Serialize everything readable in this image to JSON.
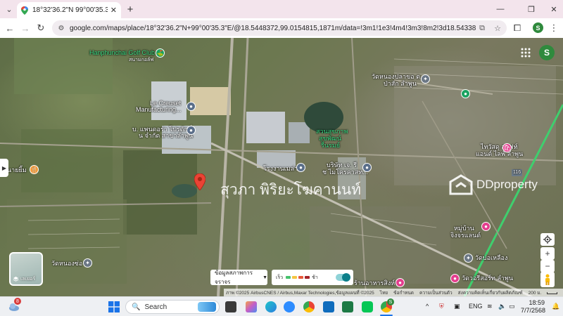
{
  "browser": {
    "tab_title": "18°32'36.2\"N 99°00'35.3\"E - Google Maps",
    "url": "google.com/maps/place/18°32'36.2\"N+99°00'35.3\"E/@18.5448372,99.0154815,1871m/data=!3m1!1e3!4m4!3m3!8m2!3d18.5433889!4d99.00980",
    "profile_initial": "S"
  },
  "map": {
    "labels": {
      "golf_club": "Hanphunchai Golf Club",
      "golf_club_th": "สนามกอล์ฟ",
      "le_creuset": "Le Creuset",
      "le_creuset_2": "Manufacturing...",
      "company_left_1": "บ. แพนดอร่า โปรดักชั่",
      "company_left_2": "น จำกัด สาขาลำพูน",
      "temple_top_1": "วัดหนองปลาขอ ต.",
      "temple_top_2": "ป่าสัก ลำพูน",
      "park_1": "สวนสุขภาพ",
      "park_2": "สุขพัฒน์",
      "park_3": "รื่นรมย์",
      "factory": "โรงงานเมล่า",
      "company_mid_1": "บริษัท เจ. รี",
      "company_mid_2": "ช ไมโครคาสท...",
      "shop_right_1": "ไทวัสดุ ลอฟท์",
      "shop_right_2": "แอนด์ ไลฟ์ ลำพูน",
      "left_edge": "นายยิ้ม",
      "village_1": "หมู่บ้าน",
      "village_2": "จิงจรแลนด์",
      "temple_bottom_right": "วัดบ่อเหลือง",
      "road_number": "116",
      "temple_left": "วัดหนองซ่อ",
      "restaurant": "ร้านอาหารสิงห์",
      "temple_bottom_2": "วัดวอรีสอร์ท ลำพูน"
    },
    "overlay_name": "สุวภา พิริยะโฆคานนท์",
    "watermark_brand": "DDproperty",
    "layers_label": "เลเยอร์",
    "traffic_label": "ข้อมูลสภาพการจราจร",
    "traffic_legend": {
      "fast": "เร็ว",
      "slow": "ช้า"
    },
    "traffic_colors": [
      "#47c26d",
      "#f5c542",
      "#e8583a",
      "#a3232a"
    ],
    "attribution": {
      "imagery": "ภาพ ©2025 AirbusCNES / Airbus,Maxar Technologies,ข้อมูลแผนที่ ©2025",
      "terms": "ไทย",
      "privacy": "ข้อกำหนด",
      "feedback": "ความเป็นส่วนตัว",
      "report": "ส่งความคิดเห็นเกี่ยวกับผลิตภัณฑ์",
      "scale": "200 ม."
    }
  },
  "taskbar": {
    "search_placeholder": "Search",
    "language": "ENG",
    "time": "18:59",
    "date": "7/7/2568",
    "weather_badge": "8",
    "chrome_badge": "S"
  }
}
